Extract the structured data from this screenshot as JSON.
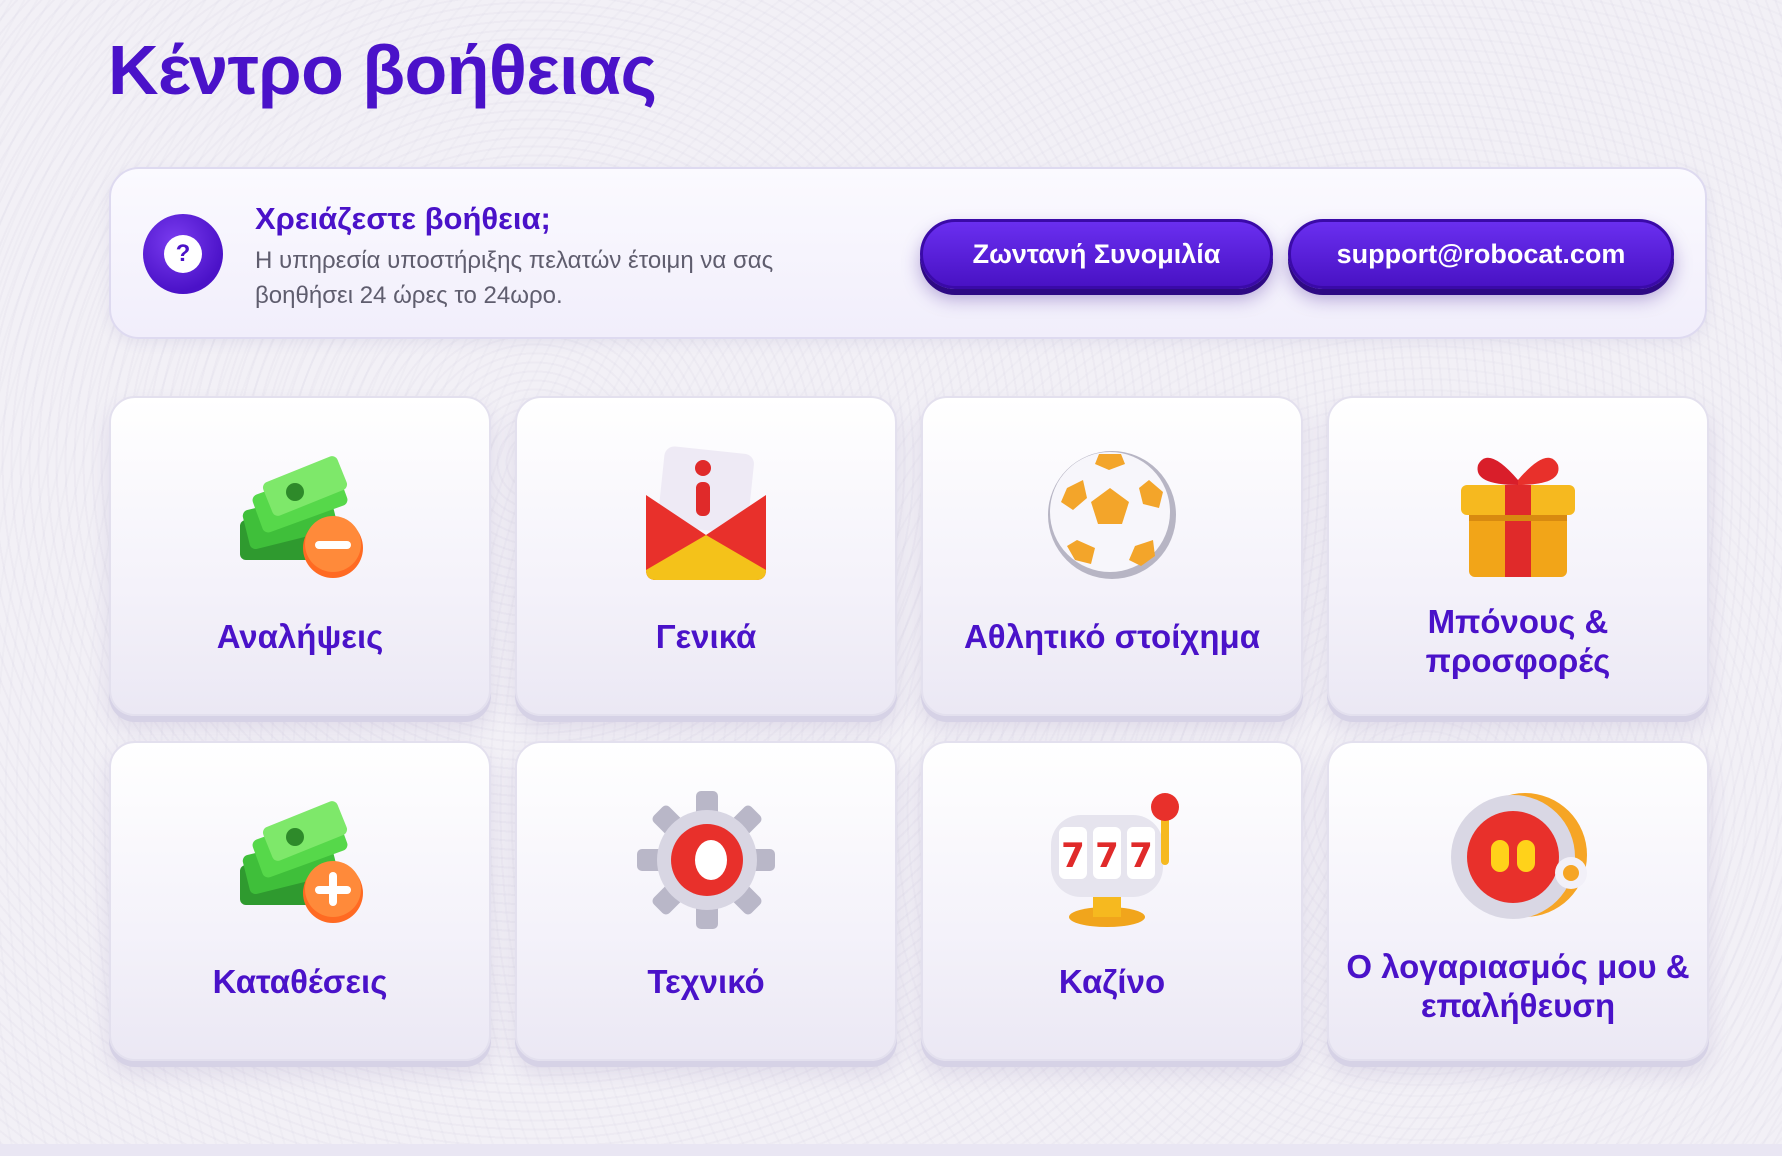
{
  "page": {
    "title": "Κέντρο βοήθειας"
  },
  "help": {
    "title": "Χρειάζεστε βοήθεια;",
    "description": "Η υπηρεσία υποστήριξης πελατών έτοιμη να σας βοηθήσει 24 ώρες το 24ωρο.",
    "icon": "question-mark-icon",
    "icon_text": "?",
    "live_chat_label": "Ζωντανή Συνομιλία",
    "email_label": "support@robocat.com"
  },
  "categories": [
    {
      "label": "Αναλήψεις",
      "icon": "money-minus-icon"
    },
    {
      "label": "Γενικά",
      "icon": "info-envelope-icon"
    },
    {
      "label": "Αθλητικό στοίχημα",
      "icon": "soccer-ball-icon"
    },
    {
      "label": "Μπόνους & προσφορές",
      "icon": "gift-box-icon"
    },
    {
      "label": "Καταθέσεις",
      "icon": "money-plus-icon"
    },
    {
      "label": "Τεχνικό",
      "icon": "gear-icon"
    },
    {
      "label": "Καζίνο",
      "icon": "slot-machine-icon"
    },
    {
      "label": "Ο λογαριασμός μου & επαλήθευση",
      "icon": "robot-head-icon"
    }
  ],
  "colors": {
    "accent": "#4a12c9",
    "background": "#f2f0f6"
  }
}
